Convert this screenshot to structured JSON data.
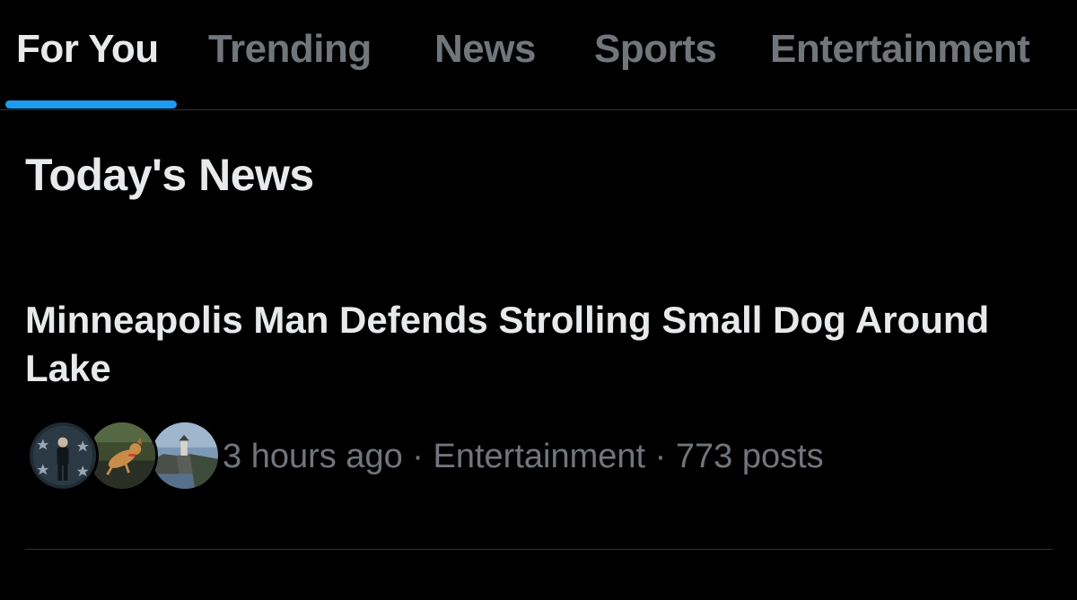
{
  "tabs": [
    {
      "label": "For You",
      "active": true
    },
    {
      "label": "Trending",
      "active": false
    },
    {
      "label": "News",
      "active": false
    },
    {
      "label": "Sports",
      "active": false
    },
    {
      "label": "Entertainment",
      "active": false
    }
  ],
  "section": {
    "title": "Today's News"
  },
  "story": {
    "headline": "Minneapolis Man Defends Strolling Small Dog Around Lake",
    "time": "3 hours ago",
    "category": "Entertainment",
    "posts": "773 posts",
    "separator": "·",
    "avatars": [
      "person-with-stars-avatar",
      "dog-avatar",
      "lighthouse-avatar"
    ]
  },
  "colors": {
    "background": "#000000",
    "primary_text": "#e7e9ea",
    "secondary_text": "#71767b",
    "accent": "#1d9bf0",
    "divider": "#2f3336"
  }
}
